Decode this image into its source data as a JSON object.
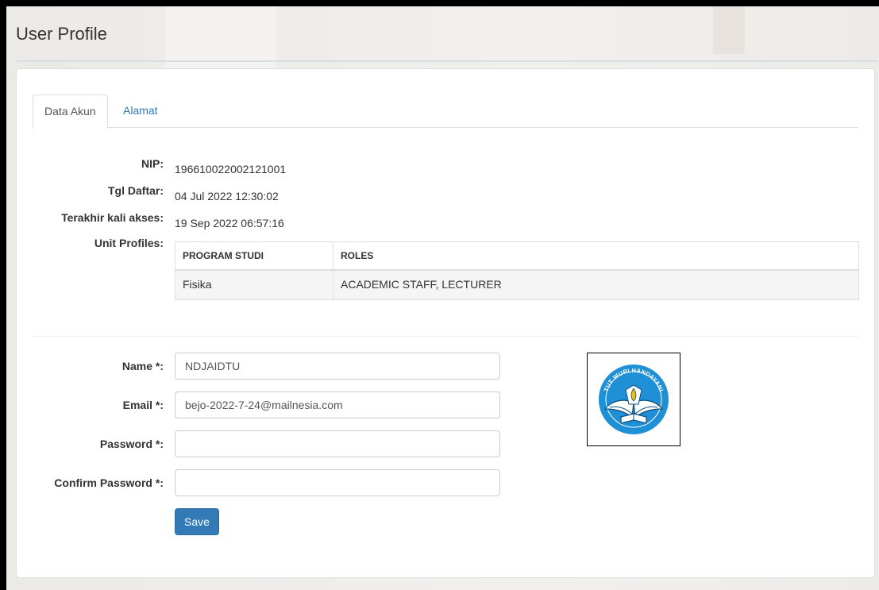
{
  "page": {
    "title": "User Profile"
  },
  "tabs": [
    {
      "label": "Data Akun",
      "active": true
    },
    {
      "label": "Alamat",
      "active": false
    }
  ],
  "account_info": {
    "nip_label": "NIP:",
    "nip_value": "196610022002121001",
    "registered_label": "Tgl Daftar:",
    "registered_value": "04 Jul 2022 12:30:02",
    "last_access_label": "Terakhir kali akses:",
    "last_access_value": "19 Sep 2022 06:57:16",
    "unit_profiles_label": "Unit Profiles:"
  },
  "unit_table": {
    "columns": [
      "PROGRAM STUDI",
      "ROLES"
    ],
    "rows": [
      [
        "Fisika",
        "ACADEMIC STAFF, LECTURER"
      ]
    ]
  },
  "form": {
    "name_label": "Name *:",
    "name_value": "NDJAIDTU",
    "email_label": "Email *:",
    "email_value": "bejo-2022-7-24@mailnesia.com",
    "password_label": "Password *:",
    "password_value": "",
    "confirm_password_label": "Confirm Password *:",
    "confirm_password_value": "",
    "save_label": "Save"
  },
  "logo": {
    "icon": "tut-wuri-handayani-emblem",
    "text": "TUT WURI HANDAYANI",
    "colors": {
      "shield": "#1f8fd6",
      "wing": "#1f8fd6",
      "book": "#ffffff",
      "flame": "#f2c200"
    }
  }
}
